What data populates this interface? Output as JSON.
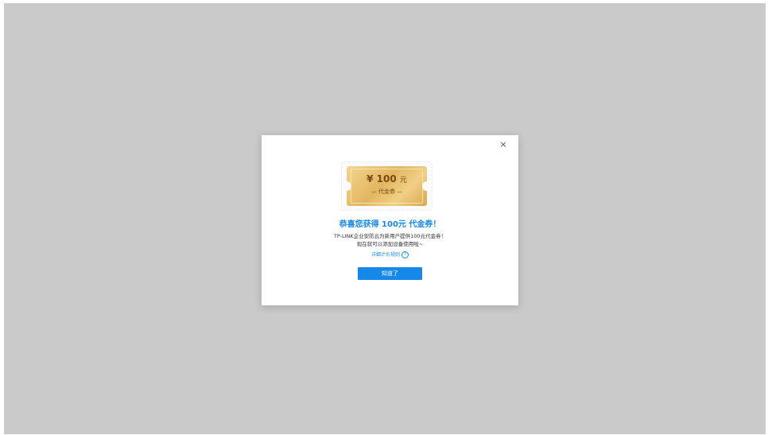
{
  "dialog": {
    "close_glyph": "×",
    "voucher": {
      "currency": "¥",
      "amount": "100",
      "unit": "元",
      "label": "— 代金券 —"
    },
    "title": "恭喜您获得 100元 代金券！",
    "description_line1": "TP-LINK企业安防云为新用户提供100元代金券！",
    "description_line2": "现在就可以添加设备使用啦~",
    "pricing_link": "详细计价规则",
    "help_glyph": "?",
    "confirm_button": "知道了"
  },
  "colors": {
    "overlay": "#cacaca",
    "accent": "#1588e9",
    "voucher_gold": "#e2b661"
  }
}
